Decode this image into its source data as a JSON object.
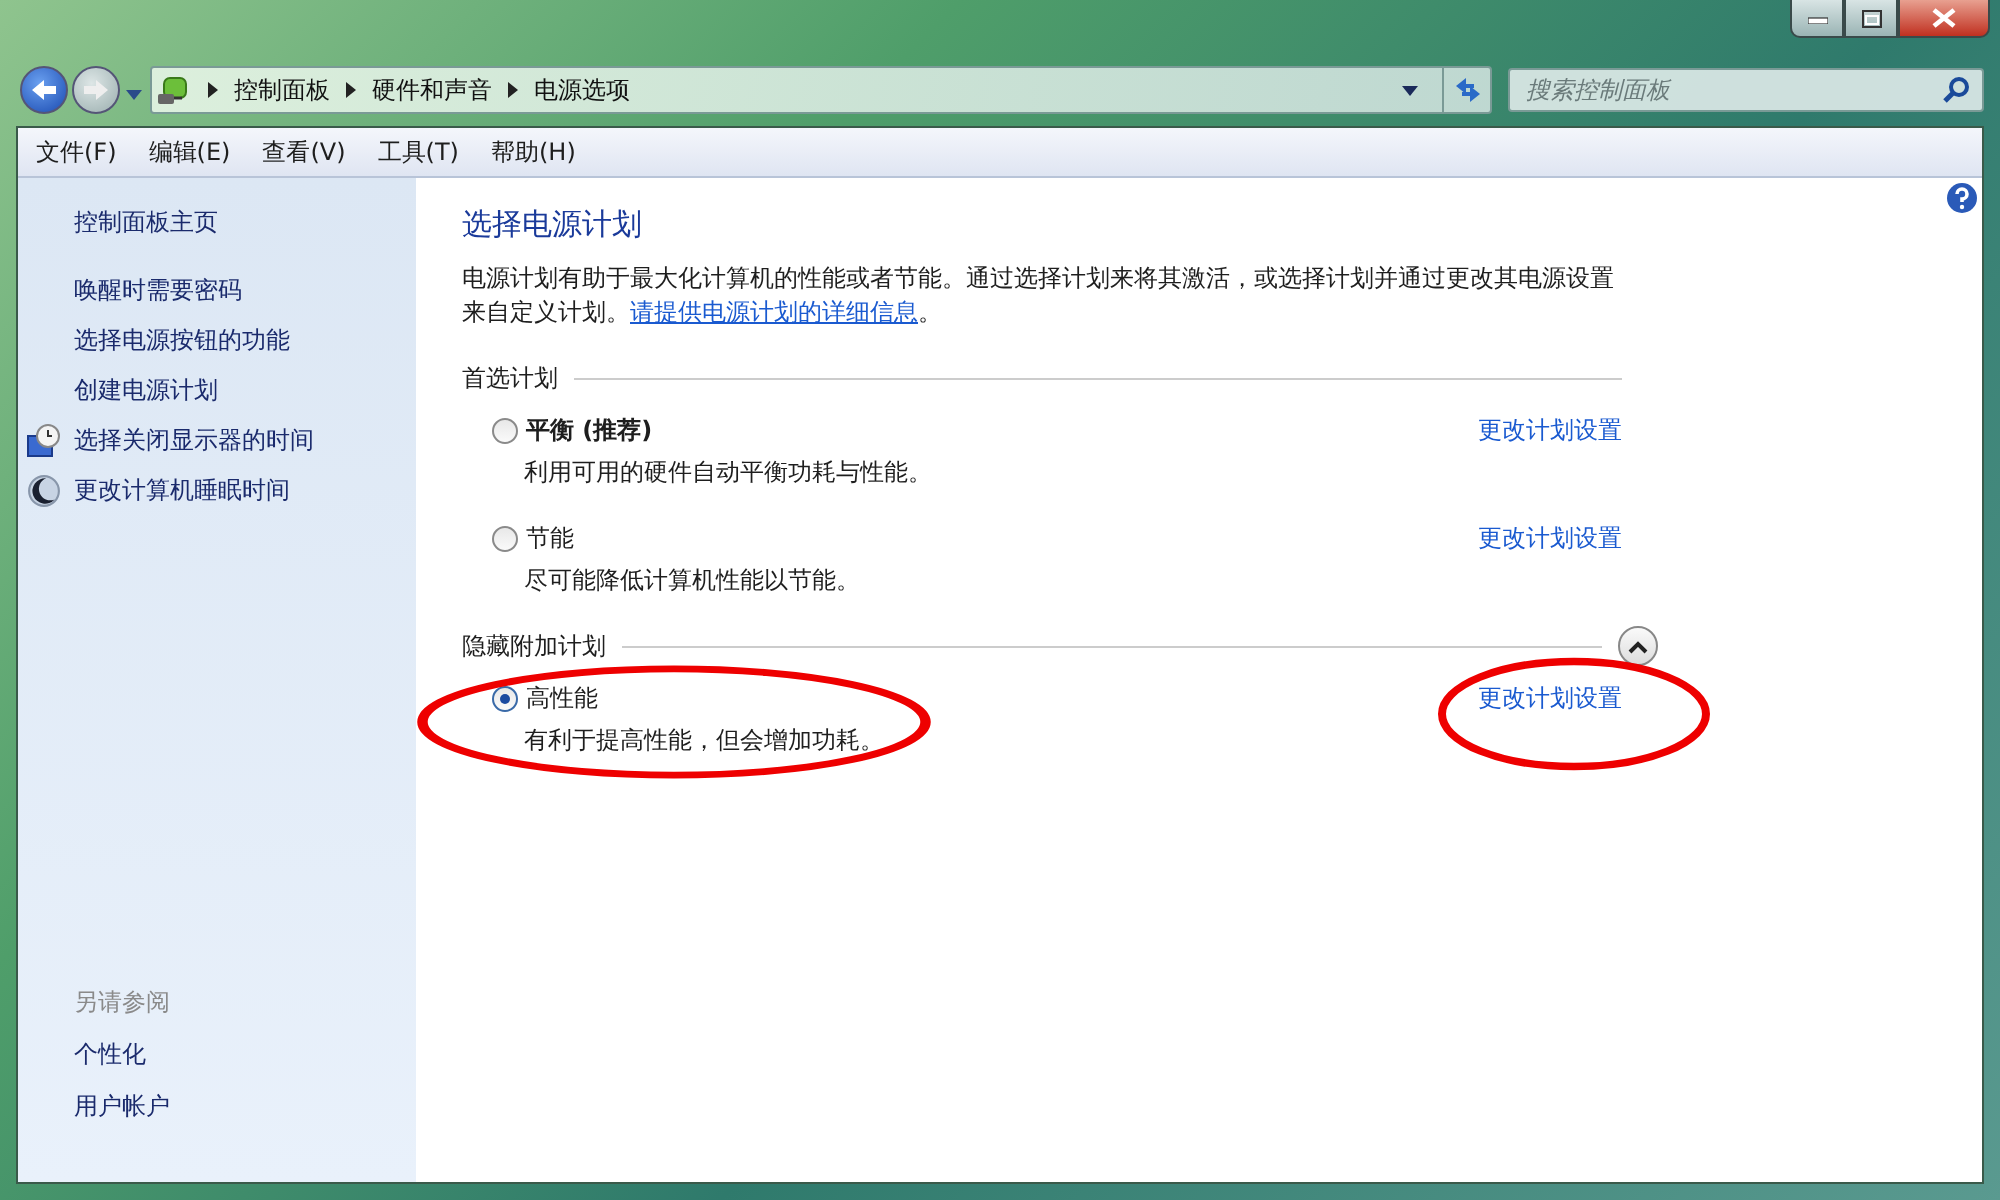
{
  "window": {
    "buttons": [
      {
        "kind": "minimize"
      },
      {
        "kind": "maximize"
      },
      {
        "kind": "close"
      }
    ]
  },
  "address_bar": {
    "crumbs": [
      "控制面板",
      "硬件和声音",
      "电源选项"
    ]
  },
  "search": {
    "placeholder": "搜索控制面板"
  },
  "menu": [
    "文件(F)",
    "编辑(E)",
    "查看(V)",
    "工具(T)",
    "帮助(H)"
  ],
  "sidebar": {
    "home": "控制面板主页",
    "items": [
      {
        "label": "唤醒时需要密码",
        "kind": "plain"
      },
      {
        "label": "选择电源按钮的功能",
        "kind": "plain"
      },
      {
        "label": "创建电源计划",
        "kind": "plain"
      },
      {
        "label": "选择关闭显示器的时间",
        "kind": "display"
      },
      {
        "label": "更改计算机睡眠时间",
        "kind": "sleep"
      }
    ],
    "see_also": "另请参阅",
    "see_also_items": [
      "个性化",
      "用户帐户"
    ]
  },
  "main": {
    "title": "选择电源计划",
    "intro": "电源计划有助于最大化计算机的性能或者节能。通过选择计划来将其激活，或选择计划并通过更改其电源设置来自定义计划。",
    "intro_link": "请提供电源计划的详细信息",
    "intro_end": "。",
    "sections": [
      {
        "title": "首选计划",
        "plans": [
          {
            "name": "平衡 (推荐)",
            "bold": true,
            "description": "利用可用的硬件自动平衡功耗与性能。",
            "link": "更改计划设置",
            "selected": false,
            "circled": false
          },
          {
            "name": "节能",
            "bold": false,
            "description": "尽可能降低计算机性能以节能。",
            "link": "更改计划设置",
            "selected": false,
            "circled": false
          }
        ]
      },
      {
        "title": "隐藏附加计划",
        "expanded": true,
        "plans": [
          {
            "name": "高性能",
            "bold": false,
            "description": "有利于提高性能，但会增加功耗。",
            "link": "更改计划设置",
            "selected": true,
            "circled": true
          }
        ]
      }
    ]
  }
}
